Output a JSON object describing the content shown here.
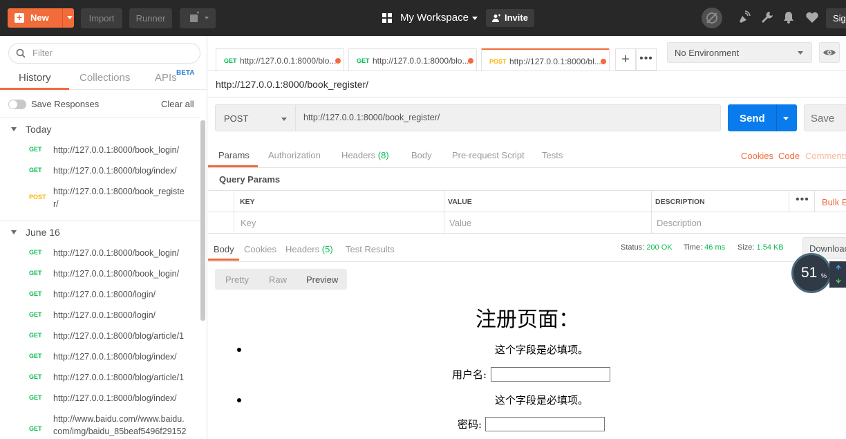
{
  "header": {
    "new_label": "New",
    "import_label": "Import",
    "runner_label": "Runner",
    "workspace": "My Workspace",
    "invite_label": "Invite",
    "signin_label": "Sig"
  },
  "sidebar": {
    "filter_placeholder": "Filter",
    "tabs": [
      "History",
      "Collections",
      "APIs"
    ],
    "beta": "BETA",
    "save_responses": "Save Responses",
    "clear_all": "Clear all",
    "groups": [
      {
        "name": "Today",
        "items": [
          {
            "method": "GET",
            "url": "http://127.0.0.1:8000/book_login/"
          },
          {
            "method": "GET",
            "url": "http://127.0.0.1:8000/blog/index/"
          },
          {
            "method": "POST",
            "url": "http://127.0.0.1:8000/book_registe",
            "url2": "r/"
          }
        ]
      },
      {
        "name": "June 16",
        "items": [
          {
            "method": "GET",
            "url": "http://127.0.0.1:8000/book_login/"
          },
          {
            "method": "GET",
            "url": "http://127.0.0.1:8000/book_login/"
          },
          {
            "method": "GET",
            "url": "http://127.0.0.1:8000/login/"
          },
          {
            "method": "GET",
            "url": "http://127.0.0.1:8000/login/"
          },
          {
            "method": "GET",
            "url": "http://127.0.0.1:8000/blog/article/1"
          },
          {
            "method": "GET",
            "url": "http://127.0.0.1:8000/blog/index/"
          },
          {
            "method": "GET",
            "url": "http://127.0.0.1:8000/blog/article/1"
          },
          {
            "method": "GET",
            "url": "http://127.0.0.1:8000/blog/index/"
          },
          {
            "method": "GET",
            "url": "http://www.baidu.com//www.baidu.",
            "url2": "com/img/baidu_85beaf5496f29152"
          }
        ]
      }
    ]
  },
  "request_tabs": [
    {
      "method": "GET",
      "url": "http://127.0.0.1:8000/blo..."
    },
    {
      "method": "GET",
      "url": "http://127.0.0.1:8000/blo..."
    },
    {
      "method": "POST",
      "url": "http://127.0.0.1:8000/bl..."
    }
  ],
  "environment": "No Environment",
  "request": {
    "title": "http://127.0.0.1:8000/book_register/",
    "method": "POST",
    "url": "http://127.0.0.1:8000/book_register/",
    "send_label": "Send",
    "save_label": "Save"
  },
  "param_tabs": {
    "params": "Params",
    "authorization": "Authorization",
    "headers": "Headers",
    "headers_count": "(8)",
    "body": "Body",
    "prerequest": "Pre-request Script",
    "tests": "Tests",
    "cookies": "Cookies",
    "code": "Code",
    "comments": "Comments"
  },
  "query_params": {
    "title": "Query Params",
    "columns": [
      "KEY",
      "VALUE",
      "DESCRIPTION"
    ],
    "placeholders": [
      "Key",
      "Value",
      "Description"
    ],
    "bulk_edit": "Bulk E"
  },
  "response": {
    "tabs": {
      "body": "Body",
      "cookies": "Cookies",
      "headers": "Headers",
      "headers_count": "(5)",
      "test_results": "Test Results"
    },
    "status_label": "Status:",
    "status": "200 OK",
    "time_label": "Time:",
    "time": "46 ms",
    "size_label": "Size:",
    "size": "1.54 KB",
    "download": "Download",
    "view_modes": [
      "Pretty",
      "Raw",
      "Preview"
    ]
  },
  "gauge": {
    "value": "51",
    "unit": "%"
  },
  "preview": {
    "heading": "注册页面：",
    "required_1": "这个字段是必填项。",
    "username_label": "用户名:",
    "required_2": "这个字段是必填项。",
    "password_label": "密码:"
  },
  "colors": {
    "accent": "#f26b3a",
    "send_blue": "#097bed",
    "get_green": "#0cbb52",
    "post_yellow": "#ffb400"
  }
}
